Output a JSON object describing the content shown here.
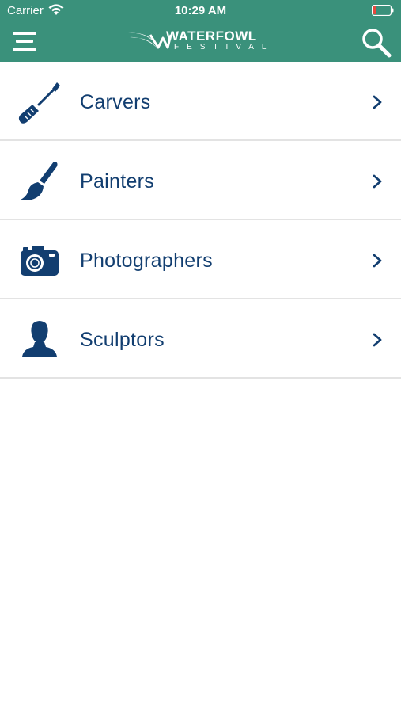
{
  "status_bar": {
    "carrier": "Carrier",
    "time": "10:29 AM",
    "wifi_icon": "wifi-icon",
    "battery_icon": "battery-low-icon",
    "battery_color": "#e8473c"
  },
  "header": {
    "background": "#3a917b",
    "menu_icon": "hamburger-menu-icon",
    "logo_title": "WATERFOWL",
    "logo_subtitle": "FESTIVAL",
    "search_icon": "search-icon"
  },
  "categories": [
    {
      "label": "Carvers",
      "icon": "screwdriver-icon"
    },
    {
      "label": "Painters",
      "icon": "paintbrush-icon"
    },
    {
      "label": "Photographers",
      "icon": "camera-icon"
    },
    {
      "label": "Sculptors",
      "icon": "person-bust-icon"
    }
  ],
  "colors": {
    "label_text": "#123e70",
    "divider": "#e3e3e3"
  }
}
